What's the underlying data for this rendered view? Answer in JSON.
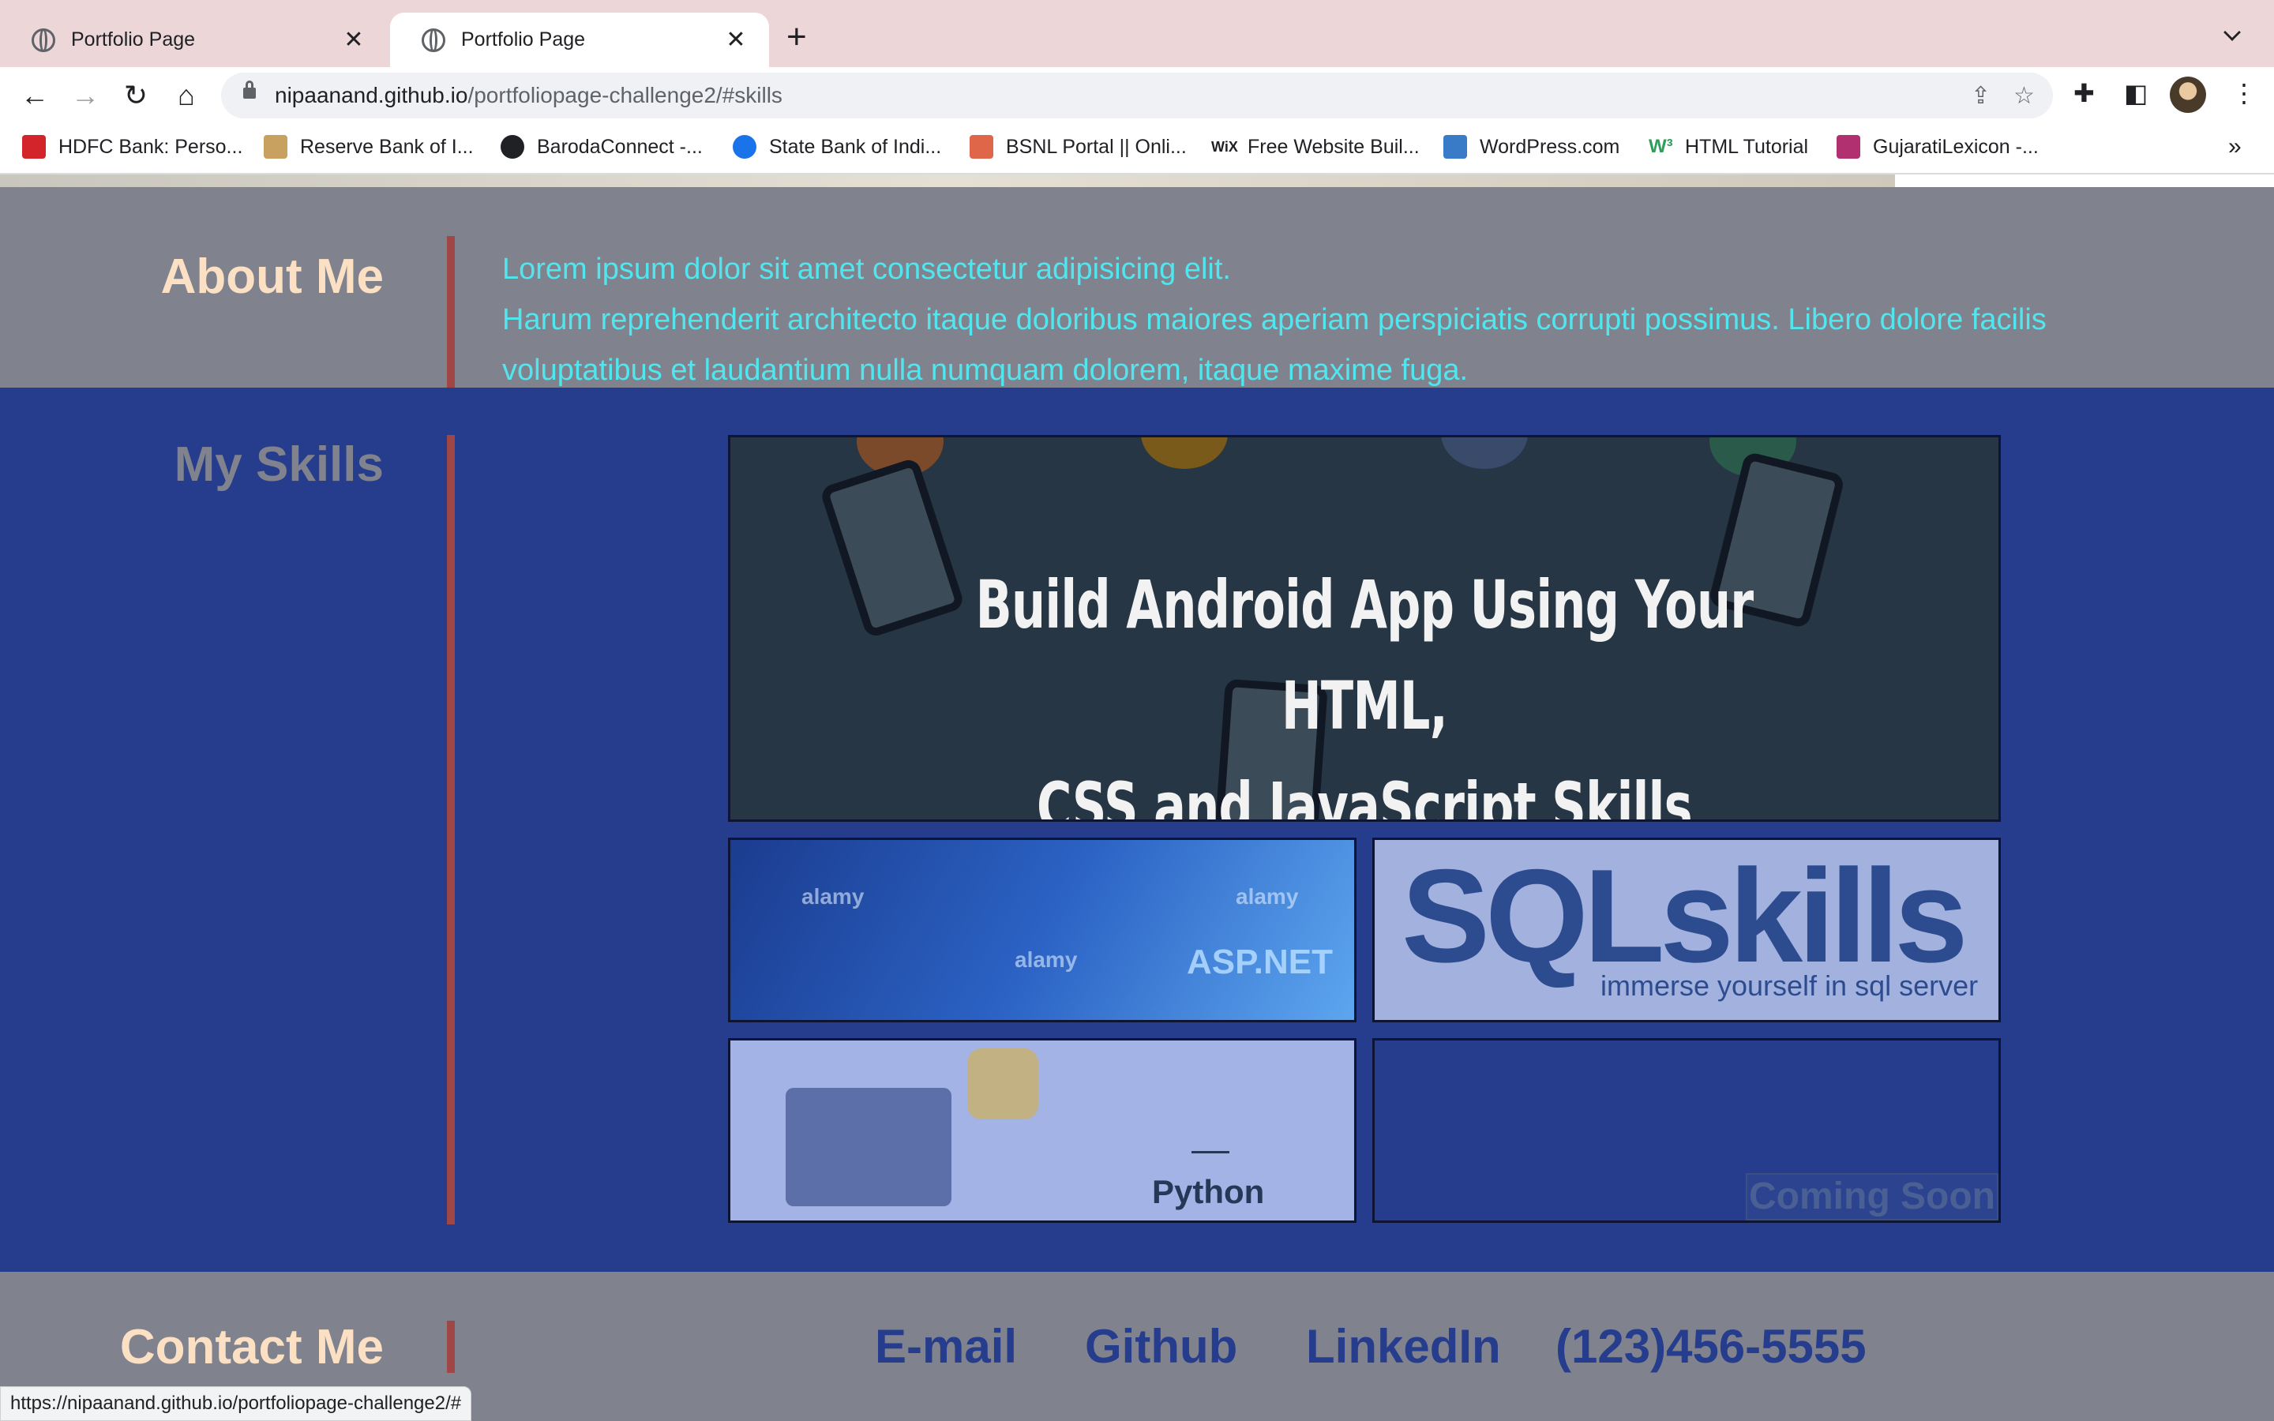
{
  "browser": {
    "tabs": [
      {
        "title": "Portfolio Page",
        "active": false
      },
      {
        "title": "Portfolio Page",
        "active": true
      }
    ],
    "url_host": "nipaanand.github.io",
    "url_path": "/portfoliopage-challenge2/#skills",
    "bookmarks": [
      {
        "label": "HDFC Bank: Perso...",
        "icon": "hdfc-icon",
        "color": "#d4242b"
      },
      {
        "label": "Reserve Bank of I...",
        "icon": "rbi-icon",
        "color": "#c8a060"
      },
      {
        "label": "BarodaConnect -...",
        "icon": "globe-icon",
        "color": "#202124"
      },
      {
        "label": "State Bank of Indi...",
        "icon": "sbi-icon",
        "color": "#1a73e8"
      },
      {
        "label": "BSNL Portal || Onli...",
        "icon": "bsnl-icon",
        "color": "#e0664a"
      },
      {
        "label": "Free Website Buil...",
        "icon": "wix-icon",
        "color": "#202124"
      },
      {
        "label": "WordPress.com",
        "icon": "wordpress-icon",
        "color": "#3a7bc8"
      },
      {
        "label": "HTML Tutorial",
        "icon": "w3schools-icon",
        "color": "#2f9e5a"
      },
      {
        "label": "GujaratiLexicon -...",
        "icon": "gujaratilexicon-icon",
        "color": "#b03070"
      }
    ]
  },
  "about": {
    "title": "About Me",
    "line1": "Lorem ipsum dolor sit amet consectetur adipisicing elit.",
    "line2": "Harum reprehenderit architecto itaque doloribus maiores aperiam perspiciatis corrupti possimus. Libero dolore facilis voluptatibus et laudantium nulla numquam dolorem, itaque maxime fuga."
  },
  "skills": {
    "title": "My Skills",
    "android_line1": "Build Android App Using Your HTML,",
    "android_line2": "CSS and JavaScript Skills",
    "asp_label": "ASP.NET",
    "asp_watermark": "alamy",
    "sql_logo": "SQLskills",
    "sql_tagline": "immerse yourself in sql server",
    "python_label": "Python",
    "coming_soon": "Coming Soon"
  },
  "contact": {
    "title": "Contact Me",
    "email": "E-mail",
    "github": "Github",
    "linkedin": "LinkedIn",
    "phone": "(123)456-5555"
  },
  "status_url": "https://nipaanand.github.io/portfoliopage-challenge2/#",
  "colors": {
    "grey_band": "#80838e",
    "skills_bg": "#263c8c",
    "heading_peach": "#fbe0c4",
    "about_text": "#51e6ee",
    "divider": "#a04646"
  }
}
